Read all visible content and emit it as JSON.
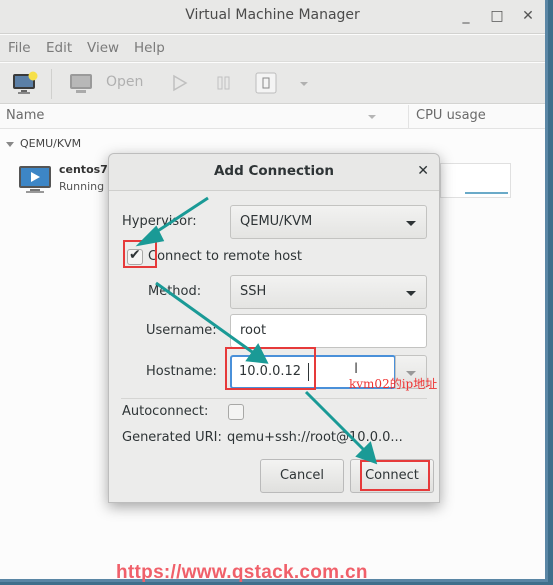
{
  "window": {
    "title": "Virtual Machine Manager",
    "controls": [
      "minimize",
      "maximize",
      "close"
    ]
  },
  "menubar": [
    "File",
    "Edit",
    "View",
    "Help"
  ],
  "toolbar": {
    "new_vm_icon": "monitor-star-icon",
    "open_label": "Open",
    "run_icon": "play-icon",
    "pause_icon": "pause-icon",
    "shutdown_icon": "power-icon",
    "more_icon": "chevron-down-icon"
  },
  "list": {
    "columns": {
      "name": "Name",
      "cpu": "CPU usage"
    },
    "group": "QEMU/KVM",
    "vms": [
      {
        "name": "centos7",
        "status": "Running"
      }
    ]
  },
  "dialog": {
    "title": "Add Connection",
    "hypervisor_label": "Hypervisor:",
    "hypervisor_value": "QEMU/KVM",
    "remote_label": "Connect to remote host",
    "remote_checked": true,
    "method_label": "Method:",
    "method_value": "SSH",
    "username_label": "Username:",
    "username_value": "root",
    "hostname_label": "Hostname:",
    "hostname_value": "10.0.0.12",
    "autoconnect_label": "Autoconnect:",
    "autoconnect_checked": false,
    "uri_label": "Generated URI:",
    "uri_value": "qemu+ssh://root@10.0.0...",
    "cancel_label": "Cancel",
    "connect_label": "Connect"
  },
  "annotations": {
    "hostname_note": "kvm02的ip地址",
    "watermark": "https://www.qstack.com.cn",
    "highlight_color": "#e63a3a",
    "arrow_color": "#1a9a96"
  }
}
